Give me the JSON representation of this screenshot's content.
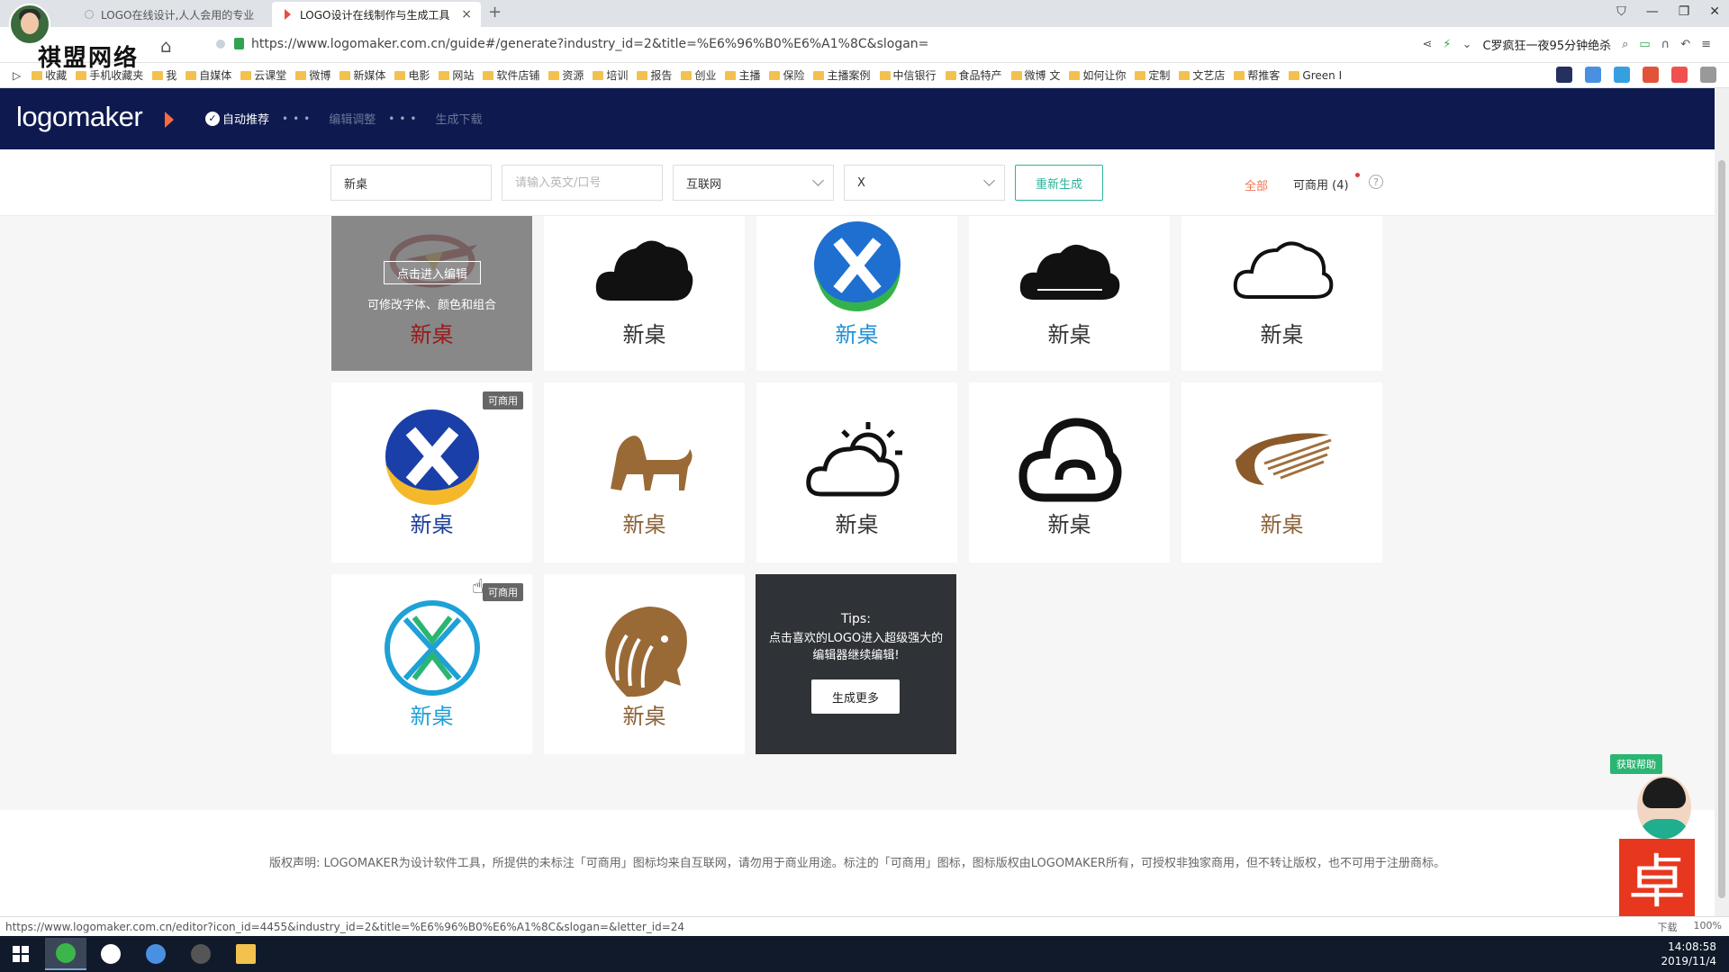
{
  "browser": {
    "tabs": [
      {
        "title": "LOGO在线设计,人人会用的专业",
        "active": false
      },
      {
        "title": "LOGO设计在线制作与生成工具",
        "active": true
      }
    ],
    "url": "https://www.logomaker.com.cn/guide#/generate?industry_id=2&title=%E6%96%B0%E6%A1%8C&slogan=",
    "hot_search": "C罗疯狂一夜95分钟绝杀",
    "bookmarks": [
      "收藏",
      "手机收藏夹",
      "我",
      "自媒体",
      "云课堂",
      "微博",
      "新媒体",
      "电影",
      "网站",
      "软件店铺",
      "资源",
      "培训",
      "报告",
      "创业",
      "主播",
      "保险",
      "主播案例",
      "中信银行",
      "食品特产",
      "微博 文",
      "如何让你",
      "定制",
      "文艺店",
      "帮推客",
      "Green I"
    ],
    "watermark": "祺盟网络",
    "status_url": "https://www.logomaker.com.cn/editor?icon_id=4455&industry_id=2&title=%E6%96%B0%E6%A1%8C&slogan=&letter_id=24",
    "status_right": [
      "下载",
      "100%"
    ]
  },
  "site": {
    "logo": "logomaker",
    "steps": [
      "自动推荐",
      "编辑调整",
      "生成下载"
    ]
  },
  "filters": {
    "title_value": "新桌",
    "slogan_placeholder": "请输入英文/口号",
    "industry": "互联网",
    "letter": "X",
    "regenerate": "重新生成",
    "tab_all": "全部",
    "tab_commercial": "可商用 (4)"
  },
  "cards": [
    {
      "name": "新桌",
      "icon": "red-wing-emblem",
      "name_color": "#8b1a1a",
      "hover": true,
      "badge": ""
    },
    {
      "name": "新桌",
      "icon": "black-cloud",
      "name_color": "#333333",
      "badge": ""
    },
    {
      "name": "新桌",
      "icon": "x-globe",
      "name_color": "#1e8fd6",
      "badge": ""
    },
    {
      "name": "新桌",
      "icon": "black-cloud-solid",
      "name_color": "#333333",
      "badge": ""
    },
    {
      "name": "新桌",
      "icon": "cloud-outline",
      "name_color": "#333333",
      "badge": ""
    },
    {
      "name": "新桌",
      "icon": "x-blue-yellow",
      "name_color": "#1a3d9a",
      "badge": "可商用"
    },
    {
      "name": "新桌",
      "icon": "golden-lion",
      "name_color": "#8b6035",
      "badge": ""
    },
    {
      "name": "新桌",
      "icon": "sun-cloud",
      "name_color": "#333333",
      "badge": ""
    },
    {
      "name": "新桌",
      "icon": "cloud-loop",
      "name_color": "#333333",
      "badge": ""
    },
    {
      "name": "新桌",
      "icon": "brown-feather",
      "name_color": "#8b6035",
      "badge": ""
    },
    {
      "name": "新桌",
      "icon": "x-circle-teal",
      "name_color": "#1e9fd6",
      "badge": "可商用"
    },
    {
      "name": "新桌",
      "icon": "lion-head",
      "name_color": "#8b6035",
      "badge": ""
    }
  ],
  "hover": {
    "edit": "点击进入编辑",
    "hint": "可修改字体、颜色和组合"
  },
  "tips": {
    "title": "Tips:",
    "text": "点击喜欢的LOGO进入超级强大的编辑器继续编辑!",
    "button": "生成更多"
  },
  "footer": {
    "copyright": "版权声明: LOGOMAKER为设计软件工具，所提供的未标注「可商用」图标均来自互联网，请勿用于商业用途。标注的「可商用」图标，图标版权由LOGOMAKER所有，可授权非独家商用，但不转让版权，也不可用于注册商标。"
  },
  "widget": {
    "help": "获取帮助",
    "brand_char": "卓"
  },
  "clock": {
    "time": "14:08:58",
    "date": "2019/11/4"
  },
  "colors": {
    "header_bg": "#0e1a4f",
    "accent": "#2bb39a",
    "all_tab": "#f07555"
  }
}
